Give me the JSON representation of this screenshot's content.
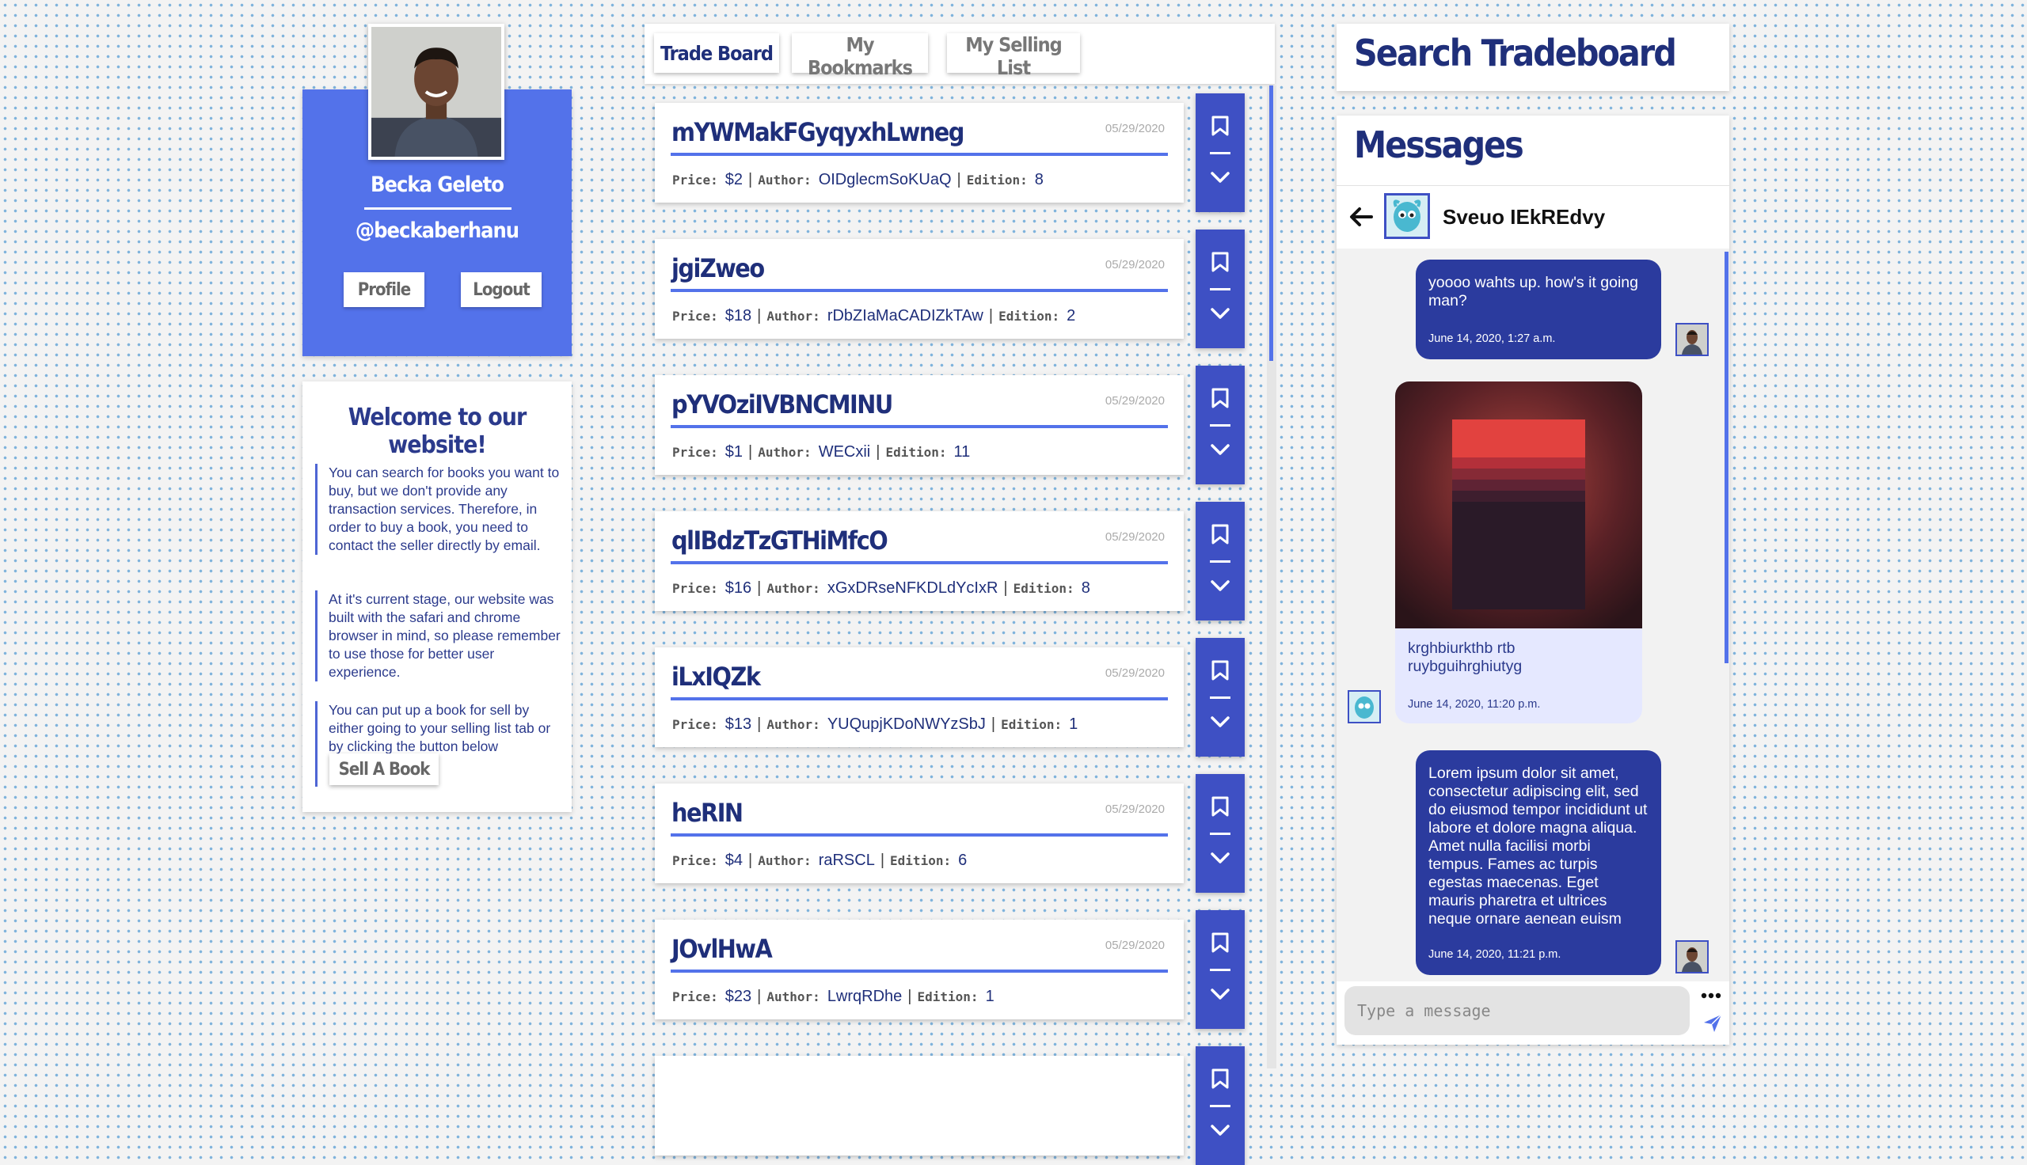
{
  "profile": {
    "name": "Becka Geleto",
    "handle": "@beckaberhanu",
    "profile_label": "Profile",
    "logout_label": "Logout"
  },
  "welcome": {
    "title": "Welcome to our website!",
    "paragraphs": [
      "You can search for books you want to buy, but we don't provide any transaction services. Therefore, in order to buy a book, you need to contact the seller directly by email.",
      "At it's current stage, our website was built with the safari and chrome browser in mind, so please remember to use those for better user experience.",
      "You can put up a book for sell by either going to your selling list tab or by clicking the button below"
    ],
    "sell_label": "Sell A Book"
  },
  "tabs": [
    "Trade Board",
    "My Bookmarks",
    "My Selling List"
  ],
  "meta_labels": {
    "price": "Price:",
    "author": "Author:",
    "edition": "Edition:"
  },
  "listings": [
    {
      "title": "mYWMakFGyqyxhLwneg",
      "date": "05/29/2020",
      "price": "$2",
      "author": "OIDglecmSoKUaQ",
      "edition": "8"
    },
    {
      "title": "jgiZweo",
      "date": "05/29/2020",
      "price": "$18",
      "author": "rDbZIaMaCADIZkTAw",
      "edition": "2"
    },
    {
      "title": "pYVOziIVBNCMINU",
      "date": "05/29/2020",
      "price": "$1",
      "author": "WECxii",
      "edition": "11"
    },
    {
      "title": "qlIBdzTzGTHiMfcO",
      "date": "05/29/2020",
      "price": "$16",
      "author": "xGxDRseNFKDLdYcIxR",
      "edition": "8"
    },
    {
      "title": "iLxIQZk",
      "date": "05/29/2020",
      "price": "$13",
      "author": "YUQupjKDoNWYzSbJ",
      "edition": "1"
    },
    {
      "title": "heRIN",
      "date": "05/29/2020",
      "price": "$4",
      "author": "raRSCL",
      "edition": "6"
    },
    {
      "title": "JOvlHwA",
      "date": "05/29/2020",
      "price": "$23",
      "author": "LwrqRDhe",
      "edition": "1"
    }
  ],
  "search": {
    "title": "Search Tradeboard"
  },
  "messages": {
    "title": "Messages",
    "contact_name": "Sveuo IEkREdvy",
    "input_placeholder": "Type a message",
    "items": [
      {
        "direction": "out",
        "text": "yoooo wahts up. how's it going man?",
        "time": "June 14, 2020, 1:27 a.m."
      },
      {
        "direction": "in",
        "text": "krghbiurkthb rtb ruybguihrghiutyg",
        "time": "June 14, 2020, 11:20 p.m.",
        "has_image": true
      },
      {
        "direction": "out",
        "text": "Lorem ipsum dolor sit amet, consectetur adipiscing elit, sed do eiusmod tempor incididunt ut labore et dolore magna aliqua. Amet nulla facilisi morbi tempus. Fames ac turpis egestas maecenas. Eget mauris pharetra et ultrices neque ornare aenean euism",
        "time": "June 14, 2020, 11:21 p.m."
      }
    ]
  },
  "colors": {
    "accent": "#5372ea",
    "dark_blue": "#2b3b9e",
    "text_navy": "#1f2f7a"
  }
}
